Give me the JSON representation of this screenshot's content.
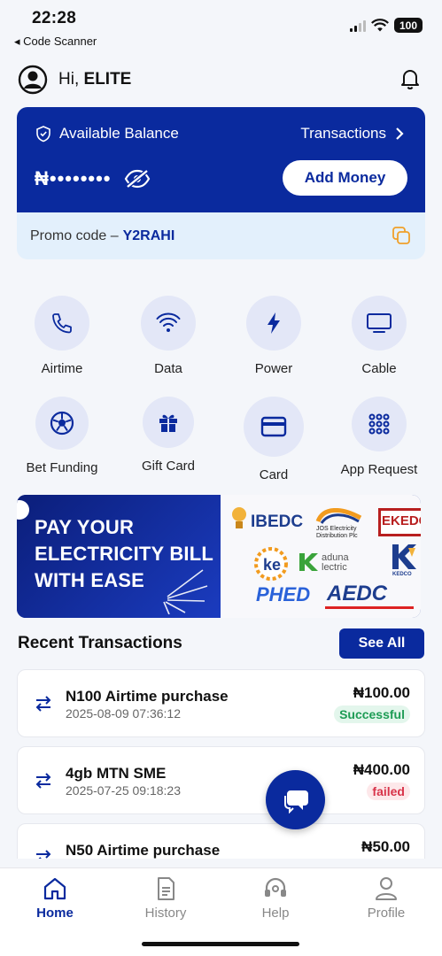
{
  "status_bar": {
    "time": "22:28",
    "back_app": "◂ Code Scanner",
    "battery": "100"
  },
  "header": {
    "greeting": "Hi,",
    "username": "ELITE"
  },
  "balance": {
    "label": "Available Balance",
    "transactions_link": "Transactions",
    "amount_masked": "₦••••••••",
    "add_money_label": "Add Money",
    "promo_label": "Promo code –",
    "promo_code": "Y2RAHI"
  },
  "services": [
    {
      "label": "Airtime",
      "icon": "phone-icon"
    },
    {
      "label": "Data",
      "icon": "wifi-icon"
    },
    {
      "label": "Power",
      "icon": "lightning-icon"
    },
    {
      "label": "Cable",
      "icon": "tv-icon"
    },
    {
      "label": "Bet Funding",
      "icon": "soccer-ball-icon"
    },
    {
      "label": "Gift Card",
      "icon": "gift-icon"
    },
    {
      "label": "Card",
      "icon": "credit-card-icon"
    },
    {
      "label": "App Request",
      "icon": "grid-icon"
    }
  ],
  "banner": {
    "line1": "PAY YOUR",
    "line2": "ELECTRICITY BILL",
    "line3": "WITH EASE",
    "logos": [
      "IBEDC",
      "JOS Electricity Distribution Plc",
      "EKEDC",
      "aduna lectric",
      "KEDCO",
      "PHED",
      "AEDC"
    ]
  },
  "recent": {
    "title": "Recent Transactions",
    "see_all": "See All",
    "items": [
      {
        "title": "N100 Airtime purchase",
        "date": "2025-08-09 07:36:12",
        "amount": "₦100.00",
        "status": "Successful"
      },
      {
        "title": "4gb MTN SME",
        "date": "2025-07-25 09:18:23",
        "amount": "₦400.00",
        "status": "failed"
      },
      {
        "title": "N50 Airtime purchase",
        "date": "",
        "amount": "₦50.00",
        "status": ""
      }
    ]
  },
  "nav": {
    "items": [
      {
        "label": "Home",
        "active": true
      },
      {
        "label": "History",
        "active": false
      },
      {
        "label": "Help",
        "active": false
      },
      {
        "label": "Profile",
        "active": false
      }
    ]
  },
  "colors": {
    "primary": "#0a2a9e",
    "success": "#1e9c55",
    "failed": "#d8344a",
    "promo_bg": "#e3f0fc"
  }
}
